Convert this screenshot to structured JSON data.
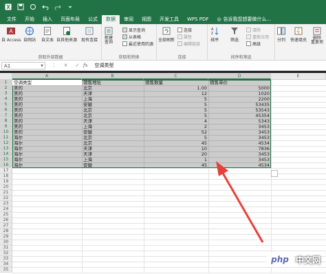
{
  "titlebar": {
    "icons": [
      "excel-logo-icon",
      "save-icon",
      "touch-icon",
      "undo-icon",
      "redo-icon",
      "customize-icon"
    ]
  },
  "tabs": [
    "文件",
    "开始",
    "插入",
    "页面布局",
    "公式",
    "数据",
    "审阅",
    "视图",
    "开发工具",
    "WPS PDF"
  ],
  "active_tab": "数据",
  "tell_me": "告诉我您想要做什么...",
  "ribbon": {
    "group1": {
      "label": "获取外部数据",
      "access": "自 Access",
      "web": "自网站",
      "text": "自文本",
      "other": "自其他来源",
      "existing": "现有连接"
    },
    "group2": {
      "label": "获取和转换",
      "newquery": "新建\n查询",
      "show": "显示查询",
      "fromtable": "从表格",
      "recent": "最近使用的源"
    },
    "group3": {
      "label": "连接",
      "refresh": "全部刷新",
      "connections": "连接",
      "props": "属性",
      "editlinks": "编辑链接"
    },
    "group4": {
      "label": "排序和筛选",
      "sort_az": "A↓Z",
      "sort": "排序",
      "filter": "筛选",
      "clear": "清除",
      "reapply": "重新应用",
      "advanced": "高级"
    },
    "group5": {
      "split": "分列",
      "flash": "快速填充",
      "dup": "删除\n重复项"
    }
  },
  "formula_bar": {
    "name_box": "A1",
    "cancel": "✕",
    "enter": "✓",
    "fx": "fx",
    "value": "空调类型"
  },
  "columns": [
    "A",
    "B",
    "C",
    "D",
    "E"
  ],
  "table": {
    "headers": [
      "空调类型",
      "销售地址",
      "销售数量",
      "销售单价"
    ],
    "rows": [
      [
        "美的",
        "北京",
        "1.00",
        "5000"
      ],
      [
        "美的",
        "天津",
        "12",
        "1020"
      ],
      [
        "美的",
        "上海",
        "5",
        "2200"
      ],
      [
        "美的",
        "安徽",
        "5",
        "53435"
      ],
      [
        "美的",
        "北京",
        "5",
        "53543"
      ],
      [
        "美的",
        "北京",
        "5",
        "45354"
      ],
      [
        "美的",
        "天津",
        "4",
        "5343"
      ],
      [
        "美的",
        "上海",
        "2",
        "3453"
      ],
      [
        "美的",
        "安徽",
        "52",
        "3453"
      ],
      [
        "海尔",
        "北京",
        "5",
        "3453"
      ],
      [
        "海尔",
        "北京",
        "45",
        "4534"
      ],
      [
        "海尔",
        "天津",
        "10",
        "7836"
      ],
      [
        "海尔",
        "天津",
        "20",
        "3453"
      ],
      [
        "海尔",
        "上海",
        "1",
        "3453"
      ],
      [
        "海尔",
        "安徽",
        "45",
        "4534"
      ]
    ]
  },
  "watermark": {
    "logo": "php",
    "text": "中文网"
  },
  "colors": {
    "accent": "#217346",
    "arrow": "#e8403a"
  }
}
